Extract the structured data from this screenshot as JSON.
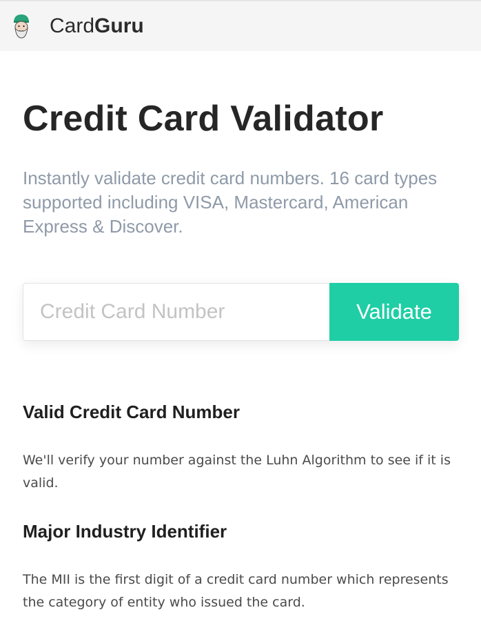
{
  "header": {
    "brand_light": "Card",
    "brand_bold": "Guru",
    "logo_icon": "guru-avatar-icon"
  },
  "hero": {
    "title": "Credit Card Validator",
    "subtitle": "Instantly validate credit card numbers. 16 card types supported including VISA, Mastercard, American Express & Discover."
  },
  "form": {
    "placeholder": "Credit Card Number",
    "button_label": "Validate"
  },
  "sections": [
    {
      "heading": "Valid Credit Card Number",
      "text": "We'll verify your number against the Luhn Algorithm to see if it is valid."
    },
    {
      "heading": "Major Industry Identifier",
      "text": "The MII is the first digit of a credit card number which represents the category of entity who issued the card."
    }
  ],
  "colors": {
    "accent": "#1fcea5",
    "subtitle": "#8e9aa8",
    "header_bg": "#f5f5f5"
  }
}
